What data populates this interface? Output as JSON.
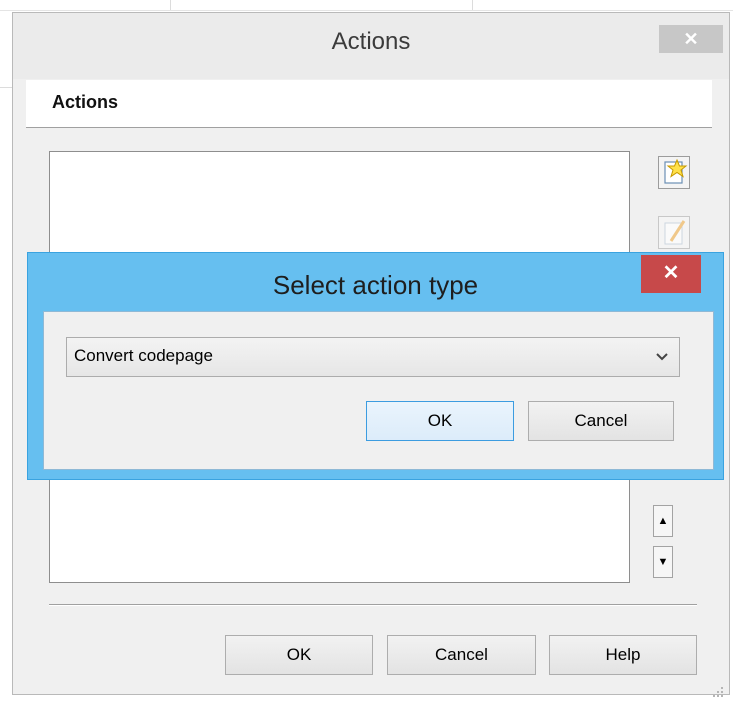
{
  "outer_dialog": {
    "title": "Actions",
    "close_glyph": "✕",
    "section_header": "Actions",
    "move_up_glyph": "▲",
    "move_down_glyph": "▼",
    "ok_label": "OK",
    "cancel_label": "Cancel",
    "help_label": "Help",
    "icons": [
      "new-action-icon",
      "edit-action-icon",
      "resize-grip-icon"
    ]
  },
  "select_dialog": {
    "title": "Select action type",
    "close_glyph": "✕",
    "selected_option": "Convert codepage",
    "ok_label": "OK",
    "cancel_label": "Cancel",
    "accent_color": "#66bff0",
    "close_color": "#c7494a"
  }
}
